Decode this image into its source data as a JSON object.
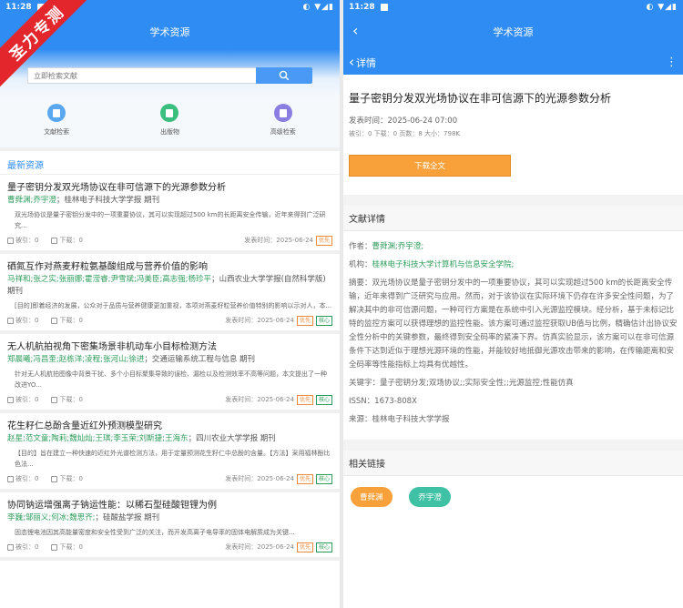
{
  "left": {
    "status_time": "11:28",
    "status_icons": "◐ ▼◢▮",
    "app_title": "学术资源",
    "banner_text": "圣力专测",
    "search_placeholder": "立即检索文献",
    "quick": [
      {
        "label": "文献检索",
        "color": "#5aa8f0"
      },
      {
        "label": "出版物",
        "color": "#3bbf7f"
      },
      {
        "label": "高级检索",
        "color": "#8a7fe0"
      }
    ],
    "section_title": "最新资源",
    "items": [
      {
        "title": "量子密钥分发双光场协议在非可信源下的光源参数分析",
        "authors": "曹舜渊;乔宇澄",
        "source": "；桂林电子科技大学学报 期刊",
        "abstract": "双光场协议是量子密钥分发中的一项重要协议，其可以实现超过500 km的长距离安全传输，近年来得到广泛研究...",
        "cited": "被引：0",
        "downloads": "下载：0",
        "date": "发表时间：2025-06-24",
        "tags": [
          "优先"
        ]
      },
      {
        "title": "硒氮互作对燕麦籽粒氨基酸组成与营养价值的影响",
        "authors": "马祥和;张之实;张丽娜;霍滢睿;尹雪斌;冯美臣;高志强;杨珍平",
        "source": "；山西农业大学学报(自然科学版) 期刊",
        "abstract": "[目的]即着经济的发展，公众对于品质与营养健康更加重视，本项对燕麦籽粒营养价值特别的影响以示对人，本...",
        "cited": "被引：0",
        "downloads": "下载：0",
        "date": "发表时间：2025-06-24",
        "tags": [
          "优先",
          "核心"
        ]
      },
      {
        "title": "无人机航拍视角下密集场景非机动车小目标检测方法",
        "authors": "郑晨曦;冯昌奎;赵栋洋;凌程;张河山;徐进",
        "source": "；交通运输系统工程与信息 期刊",
        "abstract": "针对无人机航拍图像中背景干扰、多个小目标聚集导致的误检、漏检以及检测效率不高等问题，本文提出了一种改进YO...",
        "cited": "被引：0",
        "downloads": "下载：0",
        "date": "发表时间：2025-06-24",
        "tags": [
          "优先",
          "核心"
        ]
      },
      {
        "title": "花生籽仁总酚含量近红外预测模型研究",
        "authors": "赵星;范文童;陶莉;魏灿灿;王琪;李玉荣;刘斯捷;王海东",
        "source": "；四川农业大学学报 期刊",
        "abstract": "【目的】旨在建立一种快速的近红外光谱检测方法，用于定量预测花生籽仁中总酚的含量。【方法】采用福林酚比色法...",
        "cited": "被引：0",
        "downloads": "下载：0",
        "date": "发表时间：2025-06-24",
        "tags": [
          "优先",
          "核心"
        ]
      },
      {
        "title": "协同钠运增强离子钠运性能：以稀石型硅酸钽锂为例",
        "authors": "李巍;邹丽义;何冰;魏思齐;",
        "source": "；硅酸盐学报 期刊",
        "abstract": "固态锂电池因其高能量密度和安全性受到广泛的关注，而开发高离子电导率的固体电解质成为关键...",
        "cited": "被引：0",
        "downloads": "下载：0",
        "date": "发表时间：2025-06-24",
        "tags": [
          "优先",
          "核心"
        ]
      }
    ]
  },
  "right": {
    "status_time": "11:28",
    "status_icons": "◐ ▼◢▮",
    "app_title": "学术资源",
    "back_glyph": "‹",
    "subbar_title": "详情",
    "more_glyph": "⋮",
    "title": "量子密钥分发双光场协议在非可信源下的光源参数分析",
    "publish_time": "发表时间：2025-06-24 07:00",
    "stats": "被引：0   下载：0   页数：8   大小：798K",
    "download_label": "下载全文",
    "detail_section": "文献详情",
    "author_label": "作者：",
    "author_value": "曹舜渊;乔宇澄;",
    "org_label": "机构：",
    "org_value": "桂林电子科技大学计算机与信息安全学院;",
    "abstract": "摘要：双光场协议是量子密钥分发中的一项重要协议，其可以实现超过500 km的长距离安全传输，近年来得到广泛研究与应用。然而，对于该协议在实际环境下仍存在许多安全性问题，为了解决其中的非可信源问题，一种可行方案是在系统中引入光源监控模块。经分析，基于未标记比特的监控方案可以获得理想的监控性能。该方案可通过监控获取UB值与比例，精确估计出协议安全性分析中的关键参数，最终得到安全码率的紧凑下界。仿真实验显示，该方案可以在非可信源条件下达到近似于理想光源环境的性能，并能较好地抵御光源攻击带来的影响，在传输距离和安全码率等性能指标上均具有优越性。",
    "keywords": "关键字：量子密钥分发;双场协议;;实际安全性;;光源监控;性能仿真",
    "issn": "ISSN：1673-808X",
    "origin": "来源：桂林电子科技大学学报",
    "related_section": "相关链接",
    "pills": [
      {
        "label": "曹舜渊",
        "color": "#f8a13a"
      },
      {
        "label": "乔宇澄",
        "color": "#3fc1a5"
      }
    ]
  }
}
